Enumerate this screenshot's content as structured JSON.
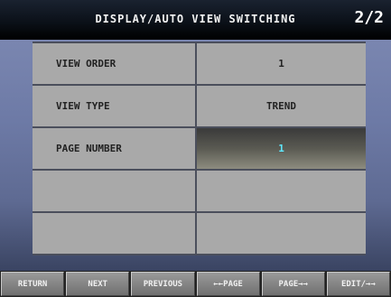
{
  "header": {
    "title": "DISPLAY/AUTO VIEW SWITCHING",
    "page_indicator": "2/2"
  },
  "settings": [
    {
      "label": "VIEW ORDER",
      "value": "1"
    },
    {
      "label": "VIEW TYPE",
      "value": "TREND"
    },
    {
      "label": "PAGE NUMBER",
      "value": "1"
    },
    {
      "label": "",
      "value": ""
    },
    {
      "label": "",
      "value": ""
    }
  ],
  "footer": {
    "buttons": [
      "RETURN",
      "NEXT",
      "PREVIOUS",
      "←←PAGE",
      "PAGE→→",
      "EDIT/→→"
    ]
  },
  "colors": {
    "active_value_text": "#5fe8ff",
    "cell_background": "#a9a9a9"
  }
}
